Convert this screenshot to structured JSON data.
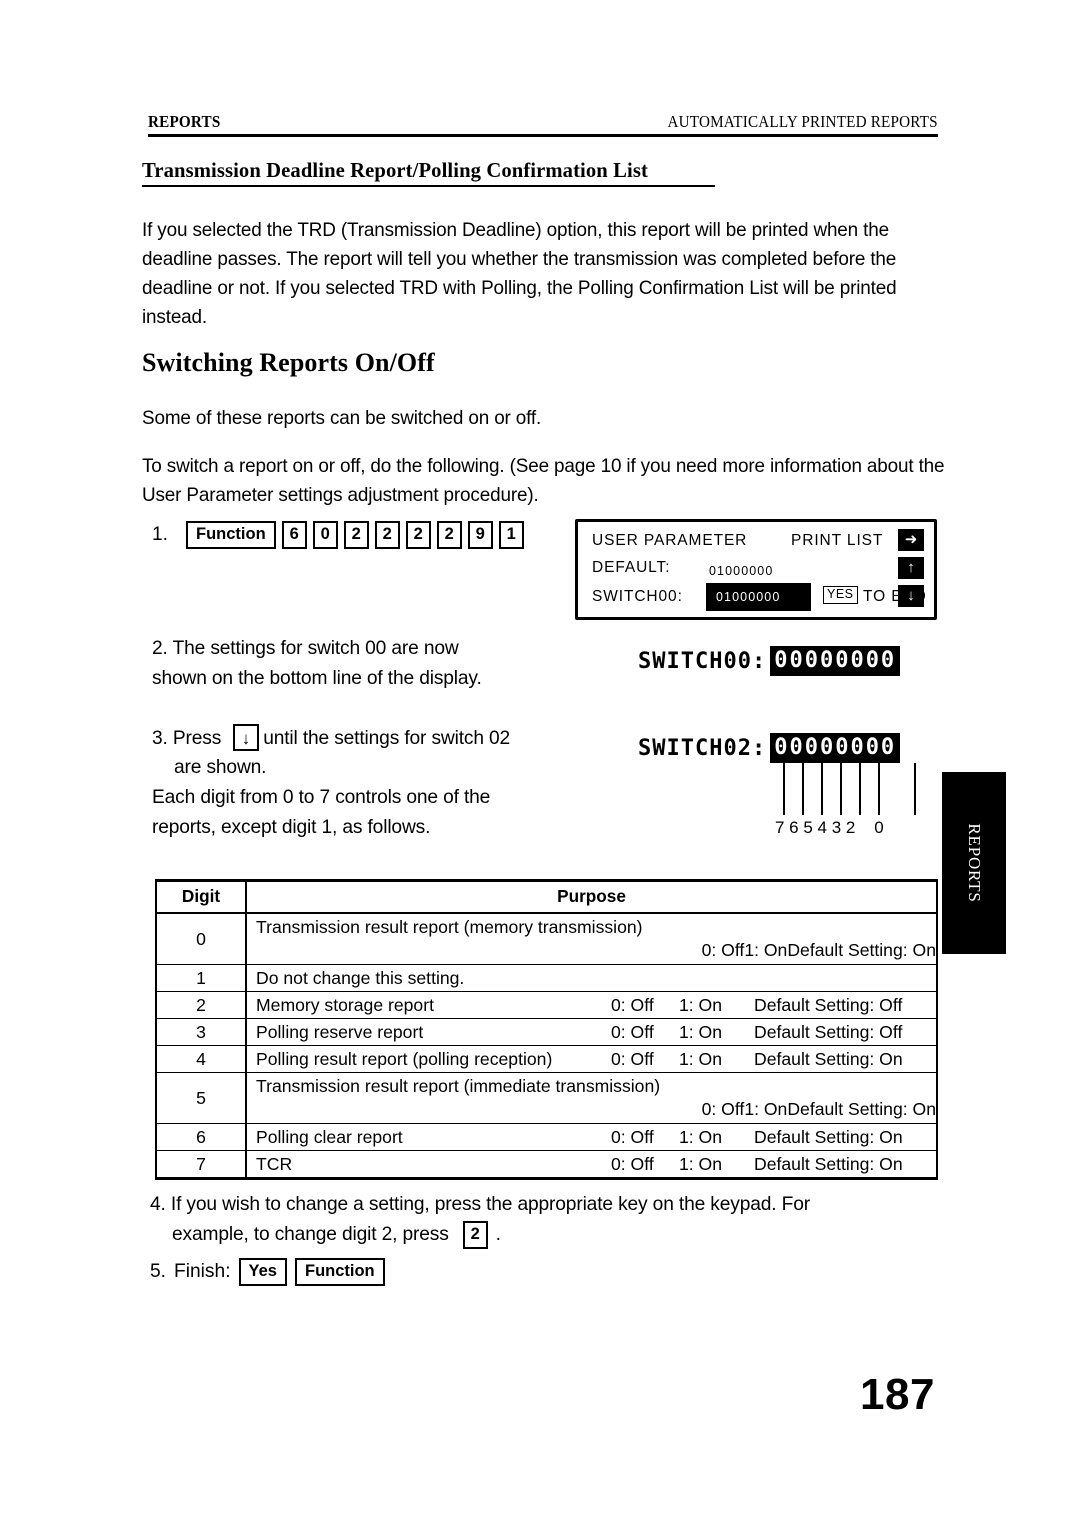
{
  "header": {
    "left": "REPORTS",
    "right": "AUTOMATICALLY PRINTED REPORTS"
  },
  "subheading": "Transmission Deadline Report/Polling Confirmation List",
  "intro_paragraph": "If you selected the TRD (Transmission Deadline) option, this report will be printed when the deadline passes. The report will tell you whether the transmission was completed before the deadline or not. If you selected TRD with Polling, the Polling Confirmation List will be printed instead.",
  "main_heading": "Switching Reports On/Off",
  "para_some": "Some of these reports can be switched on or off.",
  "para_toswitch": "To switch a report on or off, do the following. (See page 10 if you need more information about the User Parameter settings adjustment procedure).",
  "steps": {
    "step1": {
      "number": "1.",
      "keys": [
        "Function",
        "6",
        "0",
        "2",
        "2",
        "2",
        "2",
        "9",
        "1"
      ]
    },
    "step2": {
      "number": "2.",
      "text": "The settings for switch 00 are now\nshown on the bottom line of the display."
    },
    "step3": {
      "number": "3.",
      "text_before": "Press",
      "arrow_key": "↓",
      "text_after": "until the settings for switch 02",
      "text_rest": "are shown.\nEach digit from 0 to 7 controls one of the\nreports, except digit 1, as follows."
    },
    "step4": {
      "number": "4.",
      "line1": "If you wish to change a setting, press the appropriate key on the keypad. For",
      "line2_before": "example, to change digit 2, press",
      "key": "2",
      "line2_after": "."
    },
    "step5": {
      "number": "5.",
      "label": "Finish:",
      "keys": [
        "Yes",
        "Function"
      ]
    }
  },
  "lcd_panel": {
    "title": "USER PARAMETER",
    "print_list": "PRINT LIST",
    "default_label": "DEFAULT:",
    "default_value": "01000000",
    "switch_label": "SWITCH00:",
    "switch_value": "01000000",
    "yes_key": "YES",
    "to_end": "TO END",
    "arrow_right": "➜",
    "arrow_up": "↑",
    "arrow_down": "↓"
  },
  "lcd_switch00": {
    "label": "SWITCH00:",
    "value": "00000000"
  },
  "lcd_switch02": {
    "label": "SWITCH02:",
    "value": "00000000"
  },
  "digit_callouts": "7 6 5 4 3 2    0",
  "side_tab": "REPORTS",
  "table": {
    "headers": [
      "Digit",
      "Purpose"
    ],
    "rows": [
      {
        "digit": "0",
        "purpose": "Transmission result report (memory transmission)",
        "two_line": true,
        "off": "0: Off",
        "on": "1: On",
        "default": "Default Setting: On"
      },
      {
        "digit": "1",
        "purpose": "Do not change this setting.",
        "two_line": false,
        "off": "",
        "on": "",
        "default": ""
      },
      {
        "digit": "2",
        "purpose": "Memory storage report",
        "two_line": false,
        "off": "0: Off",
        "on": "1: On",
        "default": "Default Setting: Off"
      },
      {
        "digit": "3",
        "purpose": "Polling reserve report",
        "two_line": false,
        "off": "0: Off",
        "on": "1: On",
        "default": "Default Setting: Off"
      },
      {
        "digit": "4",
        "purpose": "Polling result report (polling reception)",
        "two_line": false,
        "off": "0: Off",
        "on": "1: On",
        "default": "Default Setting: On"
      },
      {
        "digit": "5",
        "purpose": "Transmission result report (immediate transmission)",
        "two_line": true,
        "off": "0: Off",
        "on": "1: On",
        "default": "Default Setting: On"
      },
      {
        "digit": "6",
        "purpose": "Polling clear report",
        "two_line": false,
        "off": "0: Off",
        "on": "1: On",
        "default": "Default Setting: On"
      },
      {
        "digit": "7",
        "purpose": "TCR",
        "two_line": false,
        "off": "0: Off",
        "on": "1: On",
        "default": "Default Setting: On"
      }
    ]
  },
  "page_number": "187"
}
